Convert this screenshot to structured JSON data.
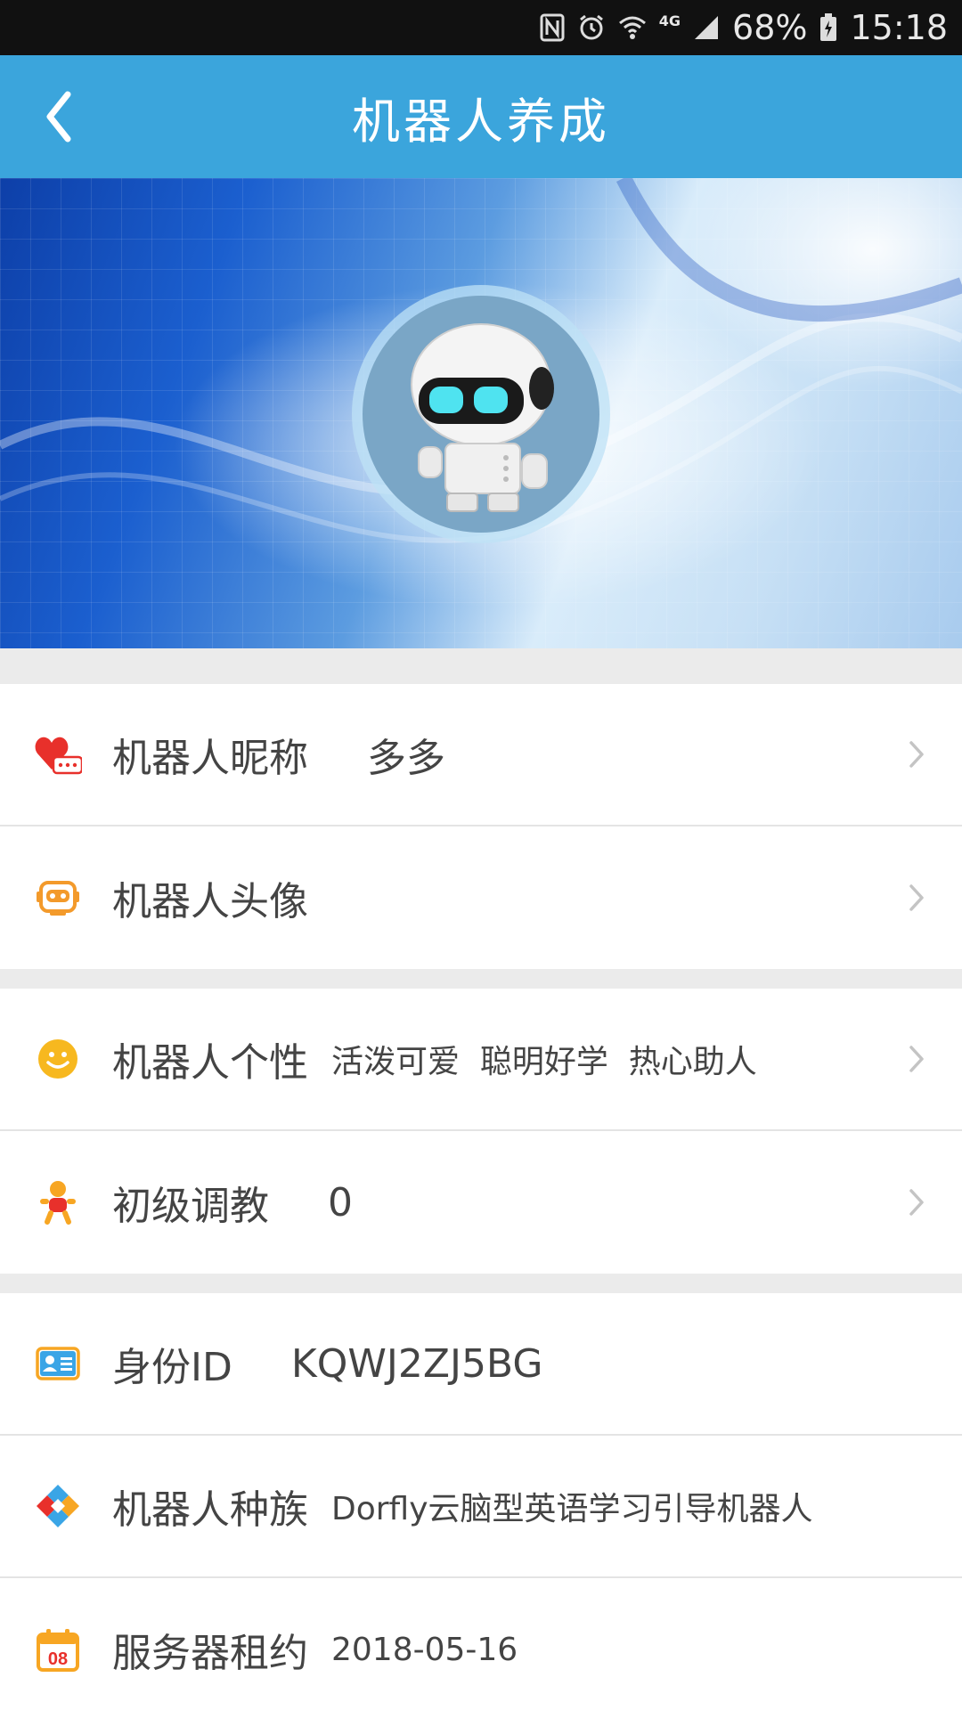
{
  "status_bar": {
    "network": "4G",
    "battery": "68%",
    "time": "15:18"
  },
  "app_bar": {
    "title": "机器人养成"
  },
  "section1": [
    {
      "icon": "heart-chat-icon",
      "label": "机器人昵称",
      "value": "多多"
    },
    {
      "icon": "robot-face-icon",
      "label": "机器人头像",
      "value": ""
    }
  ],
  "section2": [
    {
      "icon": "smiley-icon",
      "label": "机器人个性",
      "value": "活泼可爱  聪明好学  热心助人"
    },
    {
      "icon": "baby-icon",
      "label": "初级调教",
      "value": "0"
    }
  ],
  "section3": [
    {
      "icon": "id-card-icon",
      "label": "身份ID",
      "value": "KQWJ2ZJ5BG"
    },
    {
      "icon": "diamond-icon",
      "label": "机器人种族",
      "value": "Dorfly云脑型英语学习引导机器人"
    },
    {
      "icon": "calendar-icon",
      "label": "服务器租约",
      "value": "2018-05-16",
      "calendar_day": "08"
    }
  ],
  "colors": {
    "app_bar": "#3ba5dc",
    "divider": "#ebebeb"
  }
}
